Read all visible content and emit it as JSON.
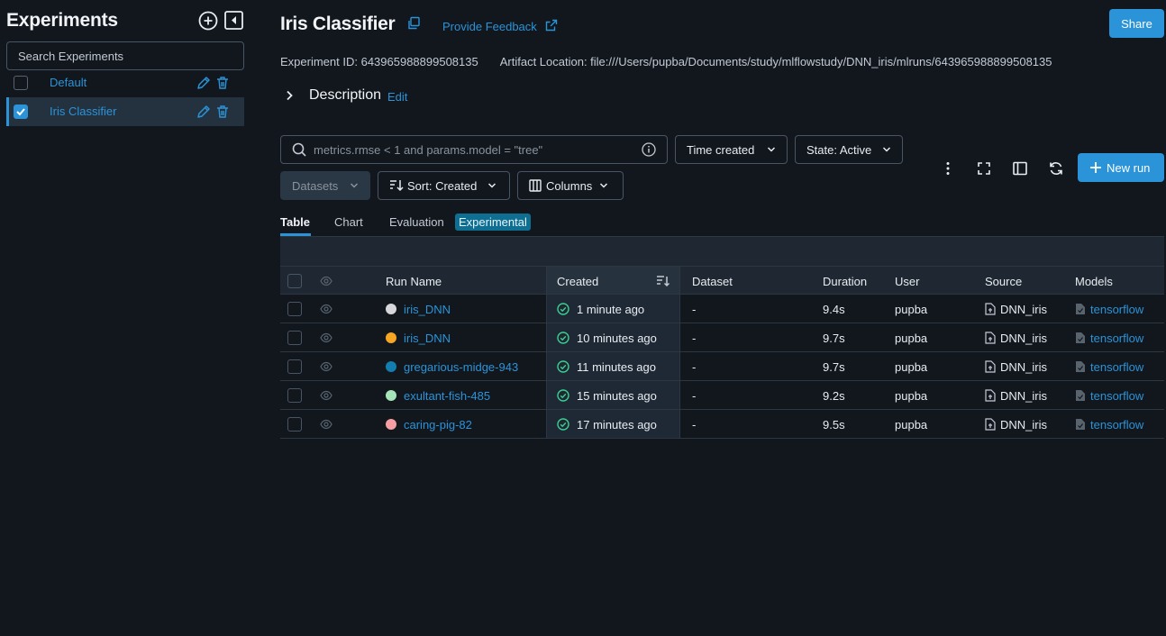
{
  "sidebar": {
    "title": "Experiments",
    "search_placeholder": "Search Experiments",
    "experiments": [
      {
        "name": "Default",
        "checked": false,
        "active": false
      },
      {
        "name": "Iris Classifier",
        "checked": true,
        "active": true
      }
    ]
  },
  "header": {
    "title": "Iris Classifier",
    "feedback_label": "Provide Feedback",
    "share_label": "Share",
    "experiment_id": "Experiment ID: 643965988899508135",
    "artifact_location": "Artifact Location: file:///Users/pupba/Documents/study/mlflowstudy/DNN_iris/mlruns/643965988899508135",
    "description_label": "Description",
    "description_edit": "Edit"
  },
  "toolbar": {
    "filter_placeholder": "metrics.rmse < 1 and params.model = \"tree\"",
    "time_created": "Time created",
    "state": "State: Active",
    "datasets": "Datasets",
    "sort": "Sort: Created",
    "columns": "Columns",
    "new_run": "New run"
  },
  "tabs": {
    "table": "Table",
    "chart": "Chart",
    "evaluation": "Evaluation",
    "experimental_badge": "Experimental"
  },
  "table": {
    "headers": {
      "run_name": "Run Name",
      "created": "Created",
      "dataset": "Dataset",
      "duration": "Duration",
      "user": "User",
      "source": "Source",
      "models": "Models"
    },
    "rows": [
      {
        "color": "#d5d7da",
        "name": "iris_DNN",
        "created": "1 minute ago",
        "dataset": "-",
        "duration": "9.4s",
        "user": "pupba",
        "source": "DNN_iris",
        "model": "tensorflow"
      },
      {
        "color": "#f7a623",
        "name": "iris_DNN",
        "created": "10 minutes ago",
        "dataset": "-",
        "duration": "9.7s",
        "user": "pupba",
        "source": "DNN_iris",
        "model": "tensorflow"
      },
      {
        "color": "#137dae",
        "name": "gregarious-midge-943",
        "created": "11 minutes ago",
        "dataset": "-",
        "duration": "9.7s",
        "user": "pupba",
        "source": "DNN_iris",
        "model": "tensorflow"
      },
      {
        "color": "#a7e3b8",
        "name": "exultant-fish-485",
        "created": "15 minutes ago",
        "dataset": "-",
        "duration": "9.2s",
        "user": "pupba",
        "source": "DNN_iris",
        "model": "tensorflow"
      },
      {
        "color": "#f59fa5",
        "name": "caring-pig-82",
        "created": "17 minutes ago",
        "dataset": "-",
        "duration": "9.5s",
        "user": "pupba",
        "source": "DNN_iris",
        "model": "tensorflow"
      }
    ]
  },
  "colors": {
    "accent": "#2b93d8",
    "background": "#11171d",
    "success": "#3ccf8e"
  },
  "icons": [
    "add-circle-icon",
    "collapse-sidebar-icon",
    "pencil-icon",
    "trash-icon",
    "copy-icon",
    "external-link-icon",
    "chevron-right-icon",
    "search-icon",
    "info-icon",
    "chevron-down-icon",
    "sort-icon",
    "columns-icon",
    "kebab-icon",
    "fullscreen-icon",
    "side-panel-icon",
    "refresh-icon",
    "plus-icon",
    "eye-icon",
    "check-circle-icon",
    "source-icon",
    "model-icon"
  ]
}
